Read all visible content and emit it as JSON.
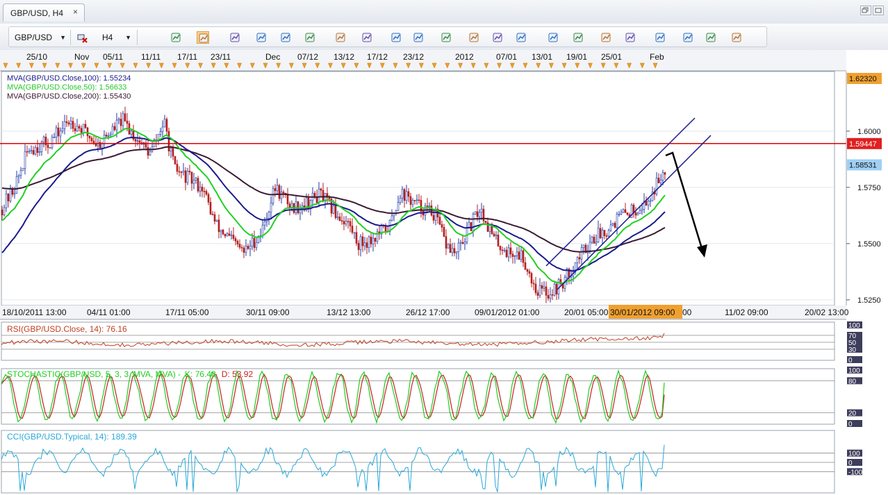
{
  "window": {
    "tab_label": "GBP/USD, H4",
    "close_glyph": "×",
    "restore_icon": "restore-icon",
    "maximize_icon": "maximize-icon"
  },
  "toolbar": {
    "symbol_select": "GBP/USD",
    "timeframe_select": "H4",
    "buttons": [
      {
        "name": "remove-indicator-button",
        "icon": "remove-indicator-icon"
      },
      {
        "name": "chart-type-button",
        "icon": "chart-type-icon"
      },
      {
        "name": "candle-view-button",
        "icon": "candle-view-icon"
      },
      {
        "name": "bar-view-button",
        "icon": "bar-view-icon"
      },
      {
        "name": "zoom-in-button",
        "icon": "zoom-in-icon"
      },
      {
        "name": "zoom-out-button",
        "icon": "zoom-out-icon"
      },
      {
        "name": "pointer-button",
        "icon": "pointer-icon"
      },
      {
        "name": "data-window-button",
        "icon": "data-window-icon"
      },
      {
        "name": "crosshair-button",
        "icon": "crosshair-icon"
      },
      {
        "name": "properties-button",
        "icon": "properties-icon"
      },
      {
        "name": "refresh-button",
        "icon": "refresh-icon"
      },
      {
        "name": "globe-button",
        "icon": "globe-icon"
      },
      {
        "name": "ruler-button",
        "icon": "ruler-icon"
      },
      {
        "name": "indicators-button",
        "icon": "indicators-icon"
      },
      {
        "name": "template-button",
        "icon": "template-icon"
      },
      {
        "name": "fibonacci-button",
        "icon": "fibonacci-icon"
      },
      {
        "name": "levels-button",
        "icon": "levels-icon"
      },
      {
        "name": "channel-button",
        "icon": "channel-icon"
      },
      {
        "name": "line-tool-button",
        "icon": "line-tool-icon"
      },
      {
        "name": "ellipse-tool-button",
        "icon": "ellipse-tool-icon"
      },
      {
        "name": "text-tool-button",
        "icon": "text-tool-icon"
      },
      {
        "name": "eraser-button",
        "icon": "eraser-icon"
      },
      {
        "name": "hierarchy-button",
        "icon": "hierarchy-icon"
      }
    ]
  },
  "chart": {
    "top_date_labels": [
      "25/10",
      "Nov",
      "05/11",
      "11/11",
      "17/11",
      "23/11",
      "Dec",
      "07/12",
      "13/12",
      "17/12",
      "23/12",
      "2012",
      "07/01",
      "13/01",
      "19/01",
      "25/01",
      "Feb"
    ],
    "bottom_date_labels": [
      "18/10/2011 13:00",
      "04/11 01:00",
      "17/11 05:00",
      "30/11 09:00",
      "13/12 13:00",
      "26/12 17:00",
      "09/01/2012 01:00",
      "20/01 05:00",
      "11/02 09:00",
      "20/02 13:00"
    ],
    "crosshair_time": "30/01/2012 09:00",
    "crosshair_time_tail": "00",
    "price_axis_labels": [
      "1.6000",
      "1.5750",
      "1.5500",
      "1.5250"
    ],
    "price_axis_values": [
      1.6,
      1.575,
      1.55,
      1.525
    ],
    "price_range": [
      1.5225,
      1.6265
    ],
    "top_price_tag": "1.62320",
    "resistance_tag": "1.59447",
    "resistance_value": 1.59447,
    "current_price_tag": "1.58531",
    "current_price_value": 1.58531,
    "legend": [
      {
        "text": "MVA(GBP/USD.Close,100): 1.55234",
        "color": "#1a1a8c"
      },
      {
        "text": "MVA(GBP/USD.Close,50): 1.56633",
        "color": "#28c828"
      },
      {
        "text": "MVA(GBP/USD.Close,200): 1.55430",
        "color": "#3a1830"
      }
    ],
    "colors": {
      "up": "#1f3aa8",
      "down": "#b41e1e",
      "ma50": "#22d022",
      "ma100": "#1a1a8c",
      "ma200": "#3c1a32",
      "resistance": "#dd0000",
      "channel": "#1a1a8c",
      "tag_orange": "#f0a030",
      "tag_red": "#e02020",
      "tag_blue": "#9fd0f4"
    }
  },
  "rsi": {
    "title": "RSI(GBP/USD.Close, 14): 76.16",
    "axis_labels": [
      "100",
      "70",
      "50",
      "30",
      "0"
    ],
    "axis_values": [
      100,
      70,
      50,
      30,
      0
    ],
    "line_color": "#c04020"
  },
  "stoch": {
    "title_main": "STOCHASTIC(GBP/USD, 5, 3, 3, MVA, MVA) -",
    "title_k": "K: 76.48",
    "title_d": "D: 53.92",
    "axis_labels": [
      "100",
      "80",
      "20",
      "0"
    ],
    "axis_values": [
      100,
      80,
      20,
      0
    ],
    "k_color": "#22cc22",
    "d_color": "#c81e1e"
  },
  "cci": {
    "title": "CCI(GBP/USD.Typical, 14): 189.39",
    "axis_labels": [
      "100",
      "0",
      "-100"
    ],
    "axis_values": [
      100,
      0,
      -100
    ],
    "line_color": "#2aa8d8"
  }
}
